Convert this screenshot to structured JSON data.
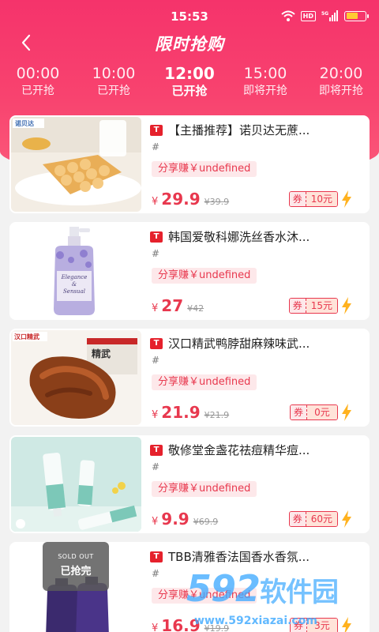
{
  "status_bar": {
    "time": "15:53",
    "hd": "HD",
    "network": "5G"
  },
  "page": {
    "title": "限时抢购"
  },
  "time_tabs": [
    {
      "time": "00:00",
      "status": "已开抢"
    },
    {
      "time": "10:00",
      "status": "已开抢"
    },
    {
      "time": "12:00",
      "status": "已开抢",
      "active": true
    },
    {
      "time": "15:00",
      "status": "即将开抢"
    },
    {
      "time": "20:00",
      "status": "即将开抢"
    }
  ],
  "platform_badge": "T",
  "products": [
    {
      "title": "【主播推荐】诺贝达无蔗...",
      "hash": "#",
      "share": "分享赚￥undefined",
      "currency": "¥",
      "price": "29.9",
      "original_price": "39.9",
      "coupon_label": "券",
      "coupon_value": "10元",
      "image_brand": "诺贝达"
    },
    {
      "title": "韩国爱敬科娜洗丝香水沐...",
      "hash": "#",
      "share": "分享赚￥undefined",
      "currency": "¥",
      "price": "27",
      "original_price": "42",
      "coupon_label": "券",
      "coupon_value": "15元",
      "image_text_1": "Elegance",
      "image_text_2": "&",
      "image_text_3": "Sensual"
    },
    {
      "title": "汉口精武鸭脖甜麻辣味武...",
      "hash": "#",
      "share": "分享赚￥undefined",
      "currency": "¥",
      "price": "21.9",
      "original_price": "21.9",
      "coupon_label": "券",
      "coupon_value": "0元",
      "image_brand": "汉口精武",
      "image_box_text": "精武"
    },
    {
      "title": "敬修堂金盏花祛痘精华痘...",
      "hash": "#",
      "share": "分享赚￥undefined",
      "currency": "¥",
      "price": "9.9",
      "original_price": "69.9",
      "coupon_label": "券",
      "coupon_value": "60元"
    },
    {
      "title": "TBB清雅香法国香水香氛...",
      "hash": "#",
      "share": "分享赚￥undefined",
      "currency": "¥",
      "price": "16.9",
      "original_price": "19.9",
      "coupon_label": "券",
      "coupon_value": "3元",
      "sold_out_en": "SOLD OUT",
      "sold_out_cn": "已抢完"
    }
  ],
  "watermark": {
    "digits": "592",
    "name": "软件园",
    "url": "www.592xiazai.com"
  }
}
